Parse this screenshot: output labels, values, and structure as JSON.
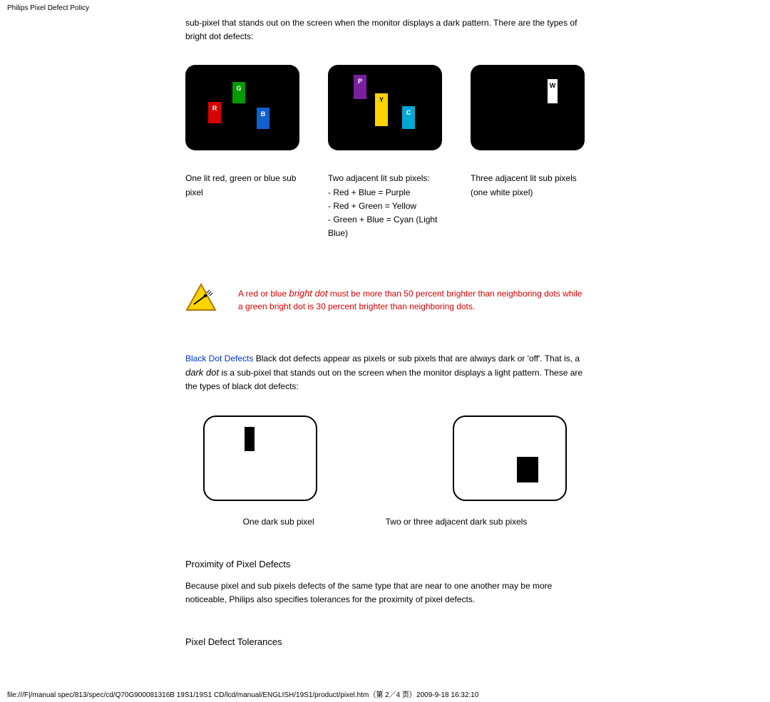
{
  "header": {
    "title": "Philips Pixel Defect Policy"
  },
  "intro": {
    "line1": "sub-pixel that stands out on the screen when the monitor displays a dark pattern. There are the types of bright dot defects:"
  },
  "bright": {
    "cap1": "One lit red, green or blue sub pixel",
    "cap2": {
      "l1": "Two adjacent lit sub pixels:",
      "l2": "- Red + Blue = Purple",
      "l3": "- Red + Green = Yellow",
      "l4": "- Green + Blue = Cyan (Light Blue)"
    },
    "cap3": "Three adjacent lit sub pixels (one white pixel)",
    "subpixels": {
      "R": "R",
      "G": "G",
      "B": "B",
      "P": "P",
      "Y": "Y",
      "C": "C",
      "W": "W"
    }
  },
  "warning": {
    "pre": "A red or blue ",
    "bold": "bright dot",
    "rest": " must be more than 50 percent brighter than neighboring dots while a green bright dot is 30 percent brighter than neighboring dots."
  },
  "black": {
    "title": "Black Dot Defects",
    "body1": " Black dot defects appear as pixels or sub pixels that are always dark or 'off'. That is, a ",
    "ital": "dark dot",
    "body2": " is a sub-pixel that stands out on the screen when the monitor displays a light pattern. These are the types of black dot defects:",
    "cap1": "One dark sub pixel",
    "cap2": "Two or three adjacent dark sub pixels"
  },
  "prox": {
    "title": "Proximity of Pixel Defects",
    "body": "Because pixel and sub pixels defects of the same type that are near to one another may be more noticeable, Philips also specifies tolerances for the proximity of pixel defects."
  },
  "tol": {
    "title": "Pixel Defect Tolerances"
  },
  "footer": {
    "text": "file:///F|/manual spec/813/spec/cd/Q70G900081316B 19S1/19S1 CD/lcd/manual/ENGLISH/19S1/product/pixel.htm（第 2／4 页）2009-9-18 16:32:10"
  }
}
